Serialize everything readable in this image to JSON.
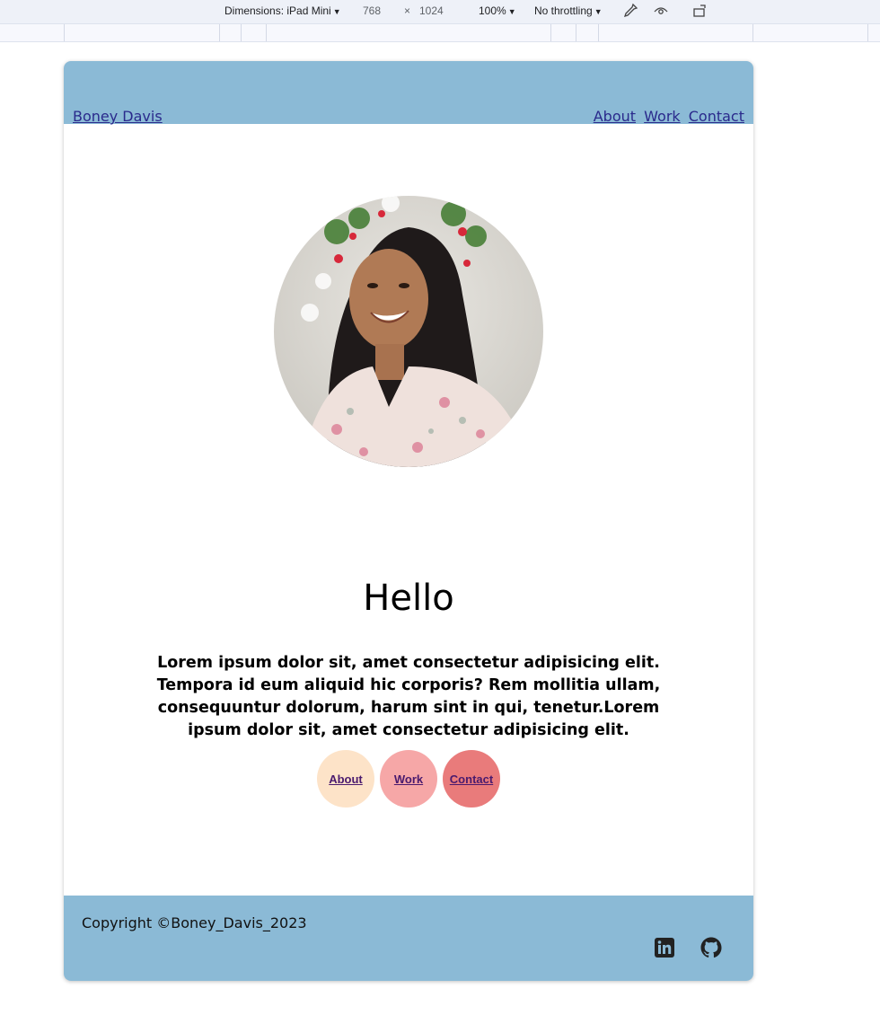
{
  "devtools": {
    "device_label": "Dimensions: iPad Mini",
    "width": "768",
    "times": "×",
    "height": "1024",
    "zoom": "100%",
    "throttling": "No throttling",
    "icons": [
      "eyedropper-icon",
      "vision-icon",
      "rotate-icon"
    ]
  },
  "header": {
    "brand": "Boney Davis",
    "nav": [
      {
        "label": "About"
      },
      {
        "label": "Work"
      },
      {
        "label": "Contact"
      }
    ]
  },
  "hero": {
    "heading": "Hello",
    "intro": "Lorem ipsum dolor sit, amet consectetur adipisicing elit. Tempora id eum aliquid hic corporis? Rem mollitia ullam, consequuntur dolorum, harum sint in qui, tenetur.Lorem ipsum dolor sit, amet consectetur adipisicing elit.",
    "buttons": [
      {
        "label": "About",
        "color": "#fde3c8"
      },
      {
        "label": "Work",
        "color": "#f6a7a7"
      },
      {
        "label": "Contact",
        "color": "#e97b7b"
      }
    ]
  },
  "footer": {
    "copyright": "Copyright ©Boney_Davis_2023",
    "icons": [
      "linkedin-icon",
      "github-icon"
    ]
  },
  "colors": {
    "header_bg": "#8bbad6",
    "footer_bg": "#8bbad6",
    "link": "#2a2a8c"
  }
}
